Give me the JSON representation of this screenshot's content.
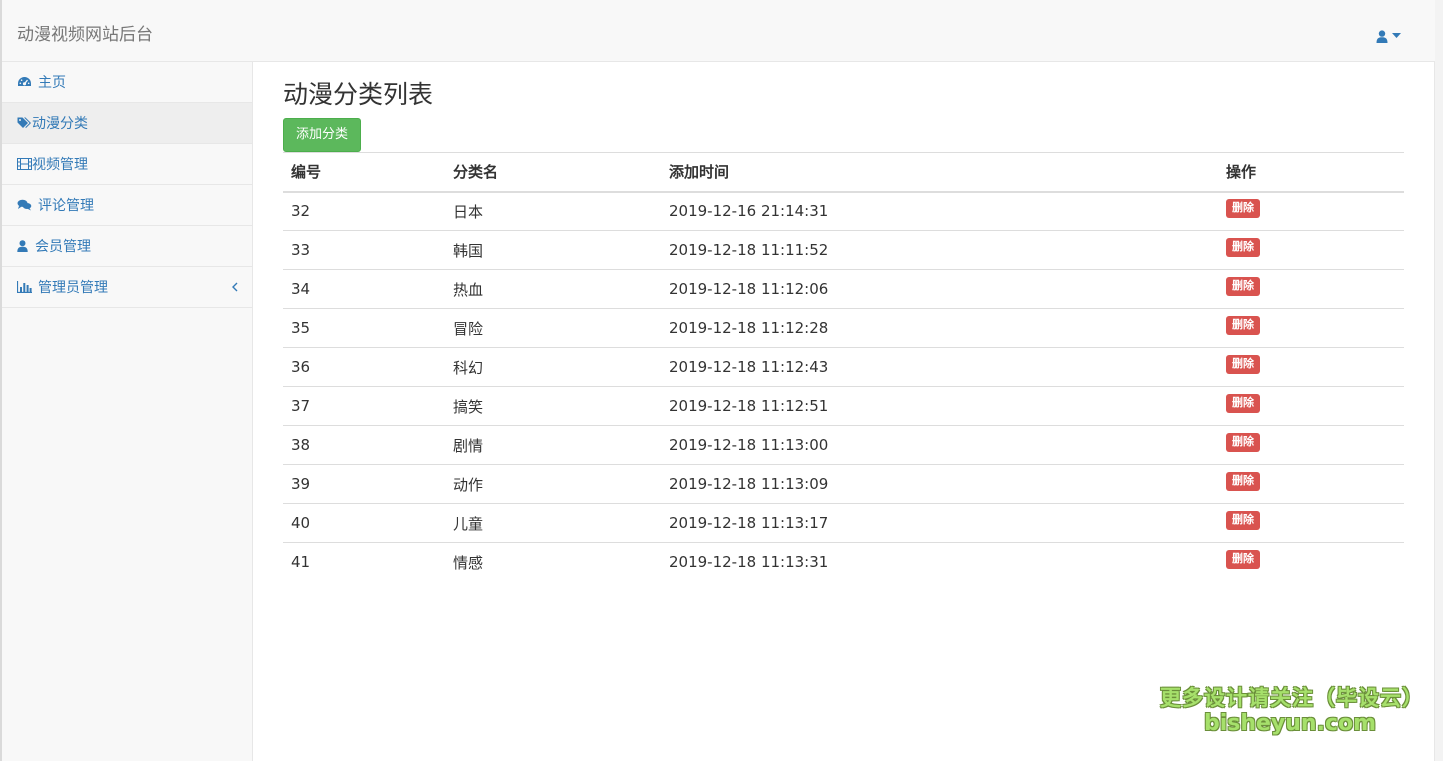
{
  "navbar": {
    "brand": "动漫视频网站后台",
    "user_icon": "user-icon",
    "caret_icon": "caret-down-icon"
  },
  "sidebar": {
    "items": [
      {
        "label": "主页",
        "icon": "dashboard-icon",
        "active": false
      },
      {
        "label": "动漫分类",
        "icon": "tags-icon",
        "active": true
      },
      {
        "label": "视频管理",
        "icon": "film-icon",
        "active": false
      },
      {
        "label": "评论管理",
        "icon": "comments-icon",
        "active": false
      },
      {
        "label": "会员管理",
        "icon": "user-icon",
        "active": false
      },
      {
        "label": "管理员管理",
        "icon": "bar-chart-icon",
        "active": false,
        "has_submenu": true
      }
    ]
  },
  "main": {
    "title": "动漫分类列表",
    "add_button": "添加分类",
    "table": {
      "headers": [
        "编号",
        "分类名",
        "添加时间",
        "操作"
      ],
      "delete_label": "删除",
      "rows": [
        {
          "id": "32",
          "name": "日本",
          "time": "2019-12-16 21:14:31"
        },
        {
          "id": "33",
          "name": "韩国",
          "time": "2019-12-18 11:11:52"
        },
        {
          "id": "34",
          "name": "热血",
          "time": "2019-12-18 11:12:06"
        },
        {
          "id": "35",
          "name": "冒险",
          "time": "2019-12-18 11:12:28"
        },
        {
          "id": "36",
          "name": "科幻",
          "time": "2019-12-18 11:12:43"
        },
        {
          "id": "37",
          "name": "搞笑",
          "time": "2019-12-18 11:12:51"
        },
        {
          "id": "38",
          "name": "剧情",
          "time": "2019-12-18 11:13:00"
        },
        {
          "id": "39",
          "name": "动作",
          "time": "2019-12-18 11:13:09"
        },
        {
          "id": "40",
          "name": "儿童",
          "time": "2019-12-18 11:13:17"
        },
        {
          "id": "41",
          "name": "情感",
          "time": "2019-12-18 11:13:31"
        }
      ]
    }
  },
  "watermark": {
    "line1": "更多设计请关注（毕设云）",
    "line2": "bisheyun.com"
  },
  "colors": {
    "link": "#337ab7",
    "success": "#5cb85c",
    "danger": "#d9534f",
    "navbar_bg": "#f8f8f8"
  }
}
